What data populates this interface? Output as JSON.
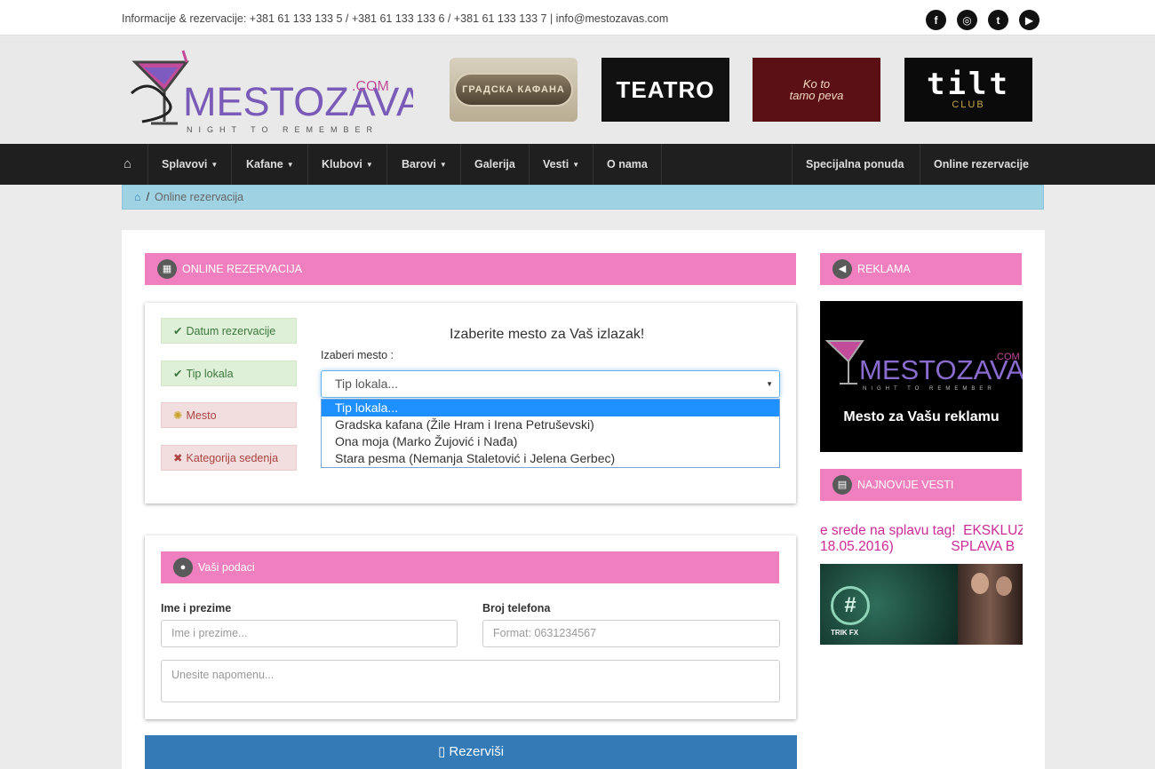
{
  "topbar": {
    "info": "Informacije & rezervacije: +381 61 133 133 5 / +381 61 133 133 6 / +381 61 133 133 7 | info@mestozavas.com",
    "social": [
      "facebook-icon",
      "instagram-icon",
      "twitter-icon",
      "youtube-icon"
    ]
  },
  "logo": {
    "name": "MESTOZAVAS",
    "domain": ".COM",
    "tagline": "NIGHT TO REMEMBER"
  },
  "venues": {
    "v1": "ГРАДСКА КАФАНА",
    "v2": "TEATRO",
    "v3_line1": "Ko to",
    "v3_line2": "tamo peva",
    "v4_big": "tilt",
    "v4_small": "CLUB"
  },
  "nav": {
    "items": [
      {
        "label": "Splavovi",
        "has_caret": true
      },
      {
        "label": "Kafane",
        "has_caret": true
      },
      {
        "label": "Klubovi",
        "has_caret": true
      },
      {
        "label": "Barovi",
        "has_caret": true
      },
      {
        "label": "Galerija",
        "has_caret": false
      },
      {
        "label": "Vesti",
        "has_caret": true
      },
      {
        "label": "O nama",
        "has_caret": false
      }
    ],
    "right_items": [
      "Specijalna ponuda",
      "Online rezervacije"
    ]
  },
  "breadcrumb": {
    "current": "Online rezervacija"
  },
  "reservation": {
    "header": "ONLINE REZERVACIJA",
    "steps": [
      {
        "label": "Datum rezervacije",
        "state": "done"
      },
      {
        "label": "Tip lokala",
        "state": "done"
      },
      {
        "label": "Mesto",
        "state": "loading"
      },
      {
        "label": "Kategorija sedenja",
        "state": "pending"
      }
    ],
    "title": "Izaberite mesto za Vaš izlazak!",
    "select_label": "Izaberi mesto :",
    "select_value": "Tip lokala...",
    "options": [
      "Tip lokala...",
      "Gradska kafana (Žile Hram i Irena Petruševski)",
      "Ona moja (Marko Žujović i Nađa)",
      "Stara pesma (Nemanja Staletović i Jelena Gerbec)"
    ]
  },
  "personal": {
    "header": "Vaši podaci",
    "name_label": "Ime i prezime",
    "name_placeholder": "Ime i prezime...",
    "phone_label": "Broj telefona",
    "phone_placeholder": "Format: 0631234567",
    "note_placeholder": "Unesite napomenu...",
    "submit": "Rezerviši"
  },
  "sidebar": {
    "ad_header": "REKLAMA",
    "ad_tagline": "Mesto za Vašu reklamu",
    "news_header": "NAJNOVIJE VESTI",
    "news_line1": "e srede na splavu tag!  EKSKLUZ",
    "news_line2": "18.05.2016)               SPLAVA B",
    "news_img_label": "TRIK FX"
  },
  "colors": {
    "accent_pink": "#ef7fbe",
    "nav_bg": "#1f1f1f",
    "button_blue": "#337ab7",
    "breadcrumb_bg": "#9fd2e3"
  }
}
